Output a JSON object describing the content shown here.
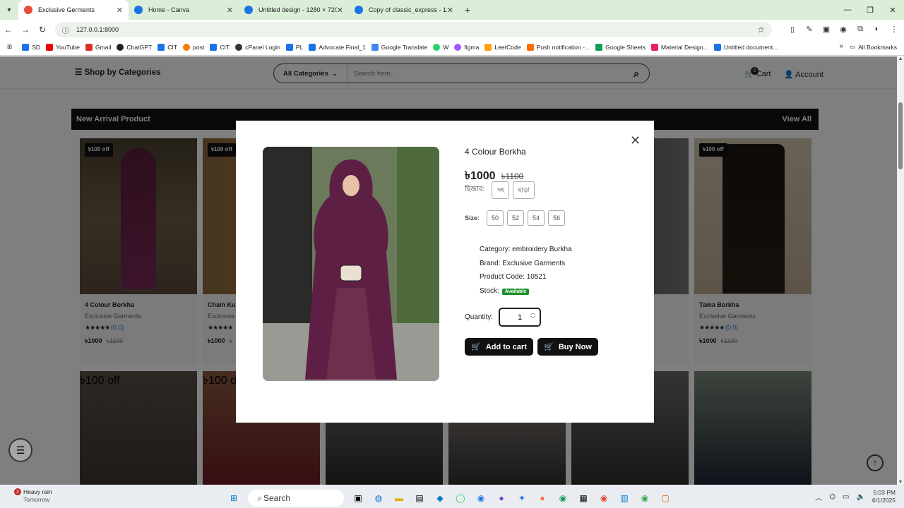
{
  "browser": {
    "tabs": [
      {
        "title": "Exclusive Germents",
        "color": "#e74c3c",
        "active": true
      },
      {
        "title": "Home - Canva",
        "color": "#1a73e8"
      },
      {
        "title": "Untitled design - 1280 × 720px",
        "color": "#1a73e8"
      },
      {
        "title": "Copy of classic_express - 1280",
        "color": "#1a73e8"
      }
    ],
    "url": "127.0.0.1:8000",
    "bookmarks": [
      "SD",
      "YouTube",
      "Gmail",
      "ChatGPT",
      "CIT",
      "post",
      "CIT",
      "cPanel Login",
      "PL",
      "Advocate Final_1",
      "Google Translate",
      "W",
      "figma",
      "LeetCode",
      "Push notification -...",
      "Google Sheets",
      "Material Design...",
      "Untitled document..."
    ],
    "all_bookmarks": "All Bookmarks"
  },
  "header": {
    "shop_by": "Shop by Categories",
    "all_categories": "All Categories",
    "search_placeholder": "Search here...",
    "cart_count": "0",
    "cart_label": "Cart",
    "account_label": "Account"
  },
  "section": {
    "title": "New Arrival Product",
    "view_all": "View All"
  },
  "products": [
    {
      "discount": "৳100 off",
      "name": "4 Colour Borkha",
      "brand": "Exclusive Garments",
      "rating": "(0.0)",
      "price": "৳1000",
      "old_price": "৳1100"
    },
    {
      "discount": "৳100 off",
      "name": "Chain Ku",
      "brand": "Exclusive",
      "rating": "",
      "price": "৳1000",
      "old_price": "৳"
    },
    {
      "discount": "৳100 off",
      "name": "Tama Borkha",
      "brand": "Exclusive Garments",
      "rating": "(0.0)",
      "price": "৳1000",
      "old_price": "৳1100"
    },
    {
      "discount": "৳100 off"
    },
    {
      "discount": "৳100 off"
    }
  ],
  "modal": {
    "title": "4 Colour Borkha",
    "price": "৳1000",
    "old_price": "৳1100",
    "hijab_label": "হিজাব:",
    "hijab_options": [
      "সহ",
      "ছাড়া"
    ],
    "size_label": "Size:",
    "sizes": [
      "50",
      "52",
      "54",
      "56"
    ],
    "category": "Category: embroidery Burkha",
    "brand": "Brand: Exclusive Garments",
    "code": "Product Code: 10521",
    "stock_label": "Stock:",
    "stock_value": "Available",
    "quantity_label": "Quantity:",
    "quantity_value": "1",
    "add_to_cart": "Add to cart",
    "buy_now": "Buy Now"
  },
  "taskbar": {
    "weather_badge": "2",
    "weather": "Heavy rain",
    "weather_sub": "Tomorrow",
    "search": "Search",
    "time": "5:03 PM",
    "date": "6/1/2025"
  }
}
